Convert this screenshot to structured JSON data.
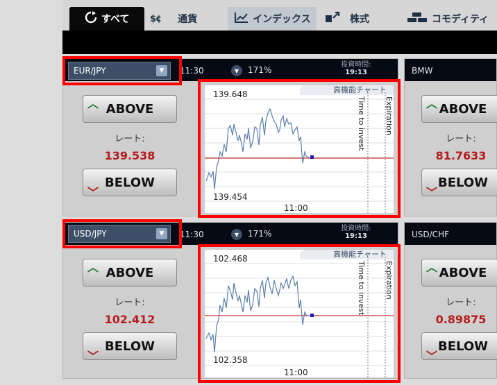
{
  "tabs": [
    {
      "label": "すべて",
      "icon": "refresh-icon",
      "active": true
    },
    {
      "label": "通貨",
      "icon": "currency-icon",
      "active": false
    },
    {
      "label": "インデックス",
      "icon": "chart-line-icon",
      "active": false
    },
    {
      "label": "株式",
      "icon": "stock-icon",
      "active": false
    },
    {
      "label": "コモディティ",
      "icon": "gold-bars-icon",
      "active": false
    }
  ],
  "widgets": [
    {
      "pair": "EUR/JPY",
      "time": "11:30",
      "payout": "171%",
      "invest_label": "投資時間:",
      "invest_time": "19:13",
      "above": "ABOVE",
      "below": "BELOW",
      "rate_label": "レート:",
      "rate": "139.538",
      "chart": {
        "title": "高機能チャート",
        "high": "139.648",
        "low": "139.454",
        "x_tick": "11:00",
        "time_to_invest": "Time to invest",
        "expiration": "Expiration"
      }
    },
    {
      "pair": "USD/JPY",
      "time": "11:30",
      "payout": "171%",
      "invest_label": "投資時間:",
      "invest_time": "19:13",
      "above": "ABOVE",
      "below": "BELOW",
      "rate_label": "レート:",
      "rate": "102.412",
      "chart": {
        "title": "高機能チャート",
        "high": "102.468",
        "low": "102.358",
        "x_tick": "11:00",
        "time_to_invest": "Time to invest",
        "expiration": "Expiration"
      }
    }
  ],
  "side_widgets": [
    {
      "pair": "BMW",
      "above": "ABOVE",
      "below": "BELOW",
      "rate_label": "レート:",
      "rate": "81.7633"
    },
    {
      "pair": "USD/CHF",
      "above": "ABOVE",
      "below": "BELOW",
      "rate_label": "レート:",
      "rate": "0.89875"
    }
  ],
  "colors": {
    "accent_red": "#ff0000",
    "rate_red": "#b51d1d",
    "up_green": "#1c7a2e",
    "header_dark": "#050a14"
  }
}
